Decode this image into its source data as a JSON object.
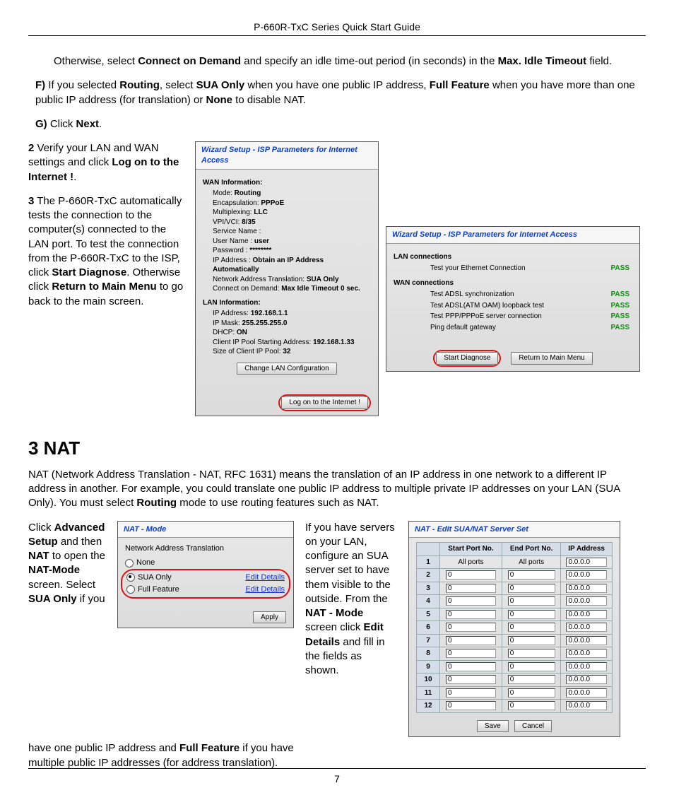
{
  "header": "P-660R-TxC Series Quick Start Guide",
  "page_number": "7",
  "intro": {
    "otherwise": "Otherwise, select ",
    "cod": "Connect on Demand",
    "otherwise2": " and specify an idle time-out period (in seconds) in the ",
    "maxidle": "Max. Idle Timeout",
    "otherwise3": " field.",
    "f1": "F)",
    "f2": " If you selected ",
    "routing": "Routing",
    "f3": ", select ",
    "suaonly": "SUA Only",
    "f4": " when you have one public IP address, ",
    "fullfeature": "Full Feature",
    "f5": " when you have more than one public IP address (for translation) or ",
    "none": "None",
    "f6": " to disable NAT.",
    "g1": "G)",
    "g2": " Click ",
    "next": "Next",
    "g3": "."
  },
  "steps": {
    "s2a": "2",
    "s2b": " Verify your LAN and WAN settings and click ",
    "s2c": "Log on to the Internet !",
    "s2d": ".",
    "s3a": "3",
    "s3b": " The P-660R-TxC automatically tests the connection to the computer(s) connected to the LAN port. To test the connection from the P-660R-TxC to the ISP, click ",
    "s3c": "Start Diagnose",
    "s3d": ". Otherwise click ",
    "s3e": "Return to Main Menu",
    "s3f": " to go back to the main screen."
  },
  "wiz1": {
    "title": "Wizard Setup - ISP Parameters for Internet Access",
    "wan": "WAN Information:",
    "mode_l": "Mode: ",
    "mode_v": "Routing",
    "encap_l": "Encapsulation: ",
    "encap_v": "PPPoE",
    "mux_l": "Multiplexing: ",
    "mux_v": "LLC",
    "vpivci_l": "VPI/VCI: ",
    "vpivci_v": "8/35",
    "svc_l": "Service Name :",
    "user_l": "User Name : ",
    "user_v": "user",
    "pass_l": "Password : ",
    "pass_v": "********",
    "ip_l": "IP Address : ",
    "ip_v": "Obtain an IP Address Automatically",
    "nat_l": "Network Address Translation: ",
    "nat_v": "SUA Only",
    "cod_l": "Connect on Demand: ",
    "cod_v": "Max Idle Timeout 0 sec.",
    "lan": "LAN Information:",
    "la_l": "IP Address: ",
    "la_v": "192.168.1.1",
    "lm_l": "IP Mask: ",
    "lm_v": "255.255.255.0",
    "dh_l": "DHCP: ",
    "dh_v": "ON",
    "cp_l": "Client IP Pool Starting Address: ",
    "cp_v": "192.168.1.33",
    "sz_l": "Size of Client IP Pool: ",
    "sz_v": "32",
    "btn_changelan": "Change LAN Configuration",
    "btn_logon": "Log on to the Internet !"
  },
  "wiz2": {
    "title": "Wizard Setup - ISP Parameters for Internet Access",
    "lan_sec": "LAN connections",
    "lan_t1": "Test your Ethernet Connection",
    "wan_sec": "WAN connections",
    "wan_t1": "Test ADSL synchronization",
    "wan_t2": "Test ADSL(ATM OAM) loopback test",
    "wan_t3": "Test PPP/PPPoE server connection",
    "wan_t4": "Ping default gateway",
    "pass": "PASS",
    "btn_start": "Start Diagnose",
    "btn_return": "Return to Main Menu"
  },
  "nat": {
    "heading": "3 NAT",
    "para1a": "NAT (Network Address Translation - NAT, RFC 1631) means the translation of an IP address in one network to a different IP address in another. For example, you could translate one public IP address to multiple private IP addresses on your LAN (SUA Only). You must select ",
    "para1b": "Routing",
    "para1c": " mode to use routing features such as NAT.",
    "left_a": "Click ",
    "left_b": "Advanced Setup",
    "left_c": " and then ",
    "left_d": "NAT",
    "left_e": " to open the ",
    "left_f": "NAT-Mode",
    "left_g": " screen. Select ",
    "left_h": "SUA Only",
    "left_i": " if you",
    "below1": "have one public IP address and ",
    "below2": "Full Feature",
    "below3": " if you have multiple public IP addresses (for address translation).",
    "mid_a": "If you have servers on your LAN, configure an SUA server set to have them visible to the outside. From the ",
    "mid_b": "NAT - Mode",
    "mid_c": " screen click ",
    "mid_d": "Edit Details",
    "mid_e": " and fill in the fields as shown."
  },
  "natmode": {
    "title": "NAT - Mode",
    "label": "Network Address Translation",
    "none": "None",
    "sua": "SUA Only",
    "full": "Full Feature",
    "edit": "Edit Details",
    "apply": "Apply"
  },
  "sua": {
    "title": "NAT - Edit SUA/NAT Server Set",
    "hdr_start": "Start Port No.",
    "hdr_end": "End Port No.",
    "hdr_ip": "IP Address",
    "allports": "All ports",
    "zero": "0",
    "ipzero": "0.0.0.0",
    "rows": [
      "1",
      "2",
      "3",
      "4",
      "5",
      "6",
      "7",
      "8",
      "9",
      "10",
      "11",
      "12"
    ],
    "save": "Save",
    "cancel": "Cancel"
  }
}
